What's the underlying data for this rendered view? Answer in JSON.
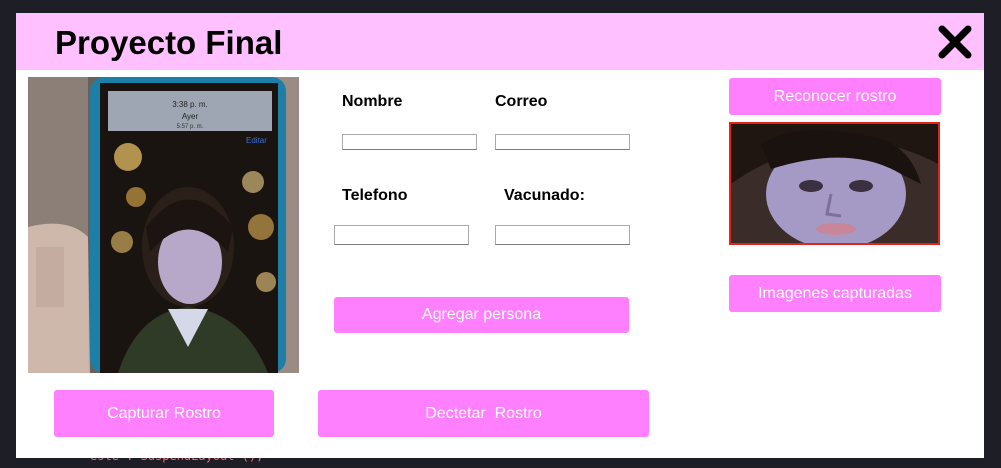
{
  "window": {
    "title": "Proyecto Final",
    "close_icon": "close-x-icon"
  },
  "background_code": {
    "bottom_line": "este . SuspendLayout ();"
  },
  "form": {
    "nombre_label": "Nombre",
    "correo_label": "Correo",
    "telefono_label": "Telefono",
    "vacunado_label": "Vacunado:",
    "nombre_value": "",
    "correo_value": "",
    "telefono_value": "",
    "vacunado_value": ""
  },
  "buttons": {
    "agregar": "Agregar persona",
    "reconocer": "Reconocer rostro",
    "imagenes": "Imagenes capturadas",
    "capturar": "Capturar Rostro",
    "detectar": "Dectetar  Rostro"
  },
  "phone_screen": {
    "time": "3:38 p. m.",
    "contact": "Ayer",
    "sub": "5:57 p. m.",
    "edit": "Editar"
  },
  "colors": {
    "titlebar": "#ffc0ff",
    "button": "#ff80ff",
    "face_border": "#e2231a",
    "window_bg": "#ffffff"
  }
}
